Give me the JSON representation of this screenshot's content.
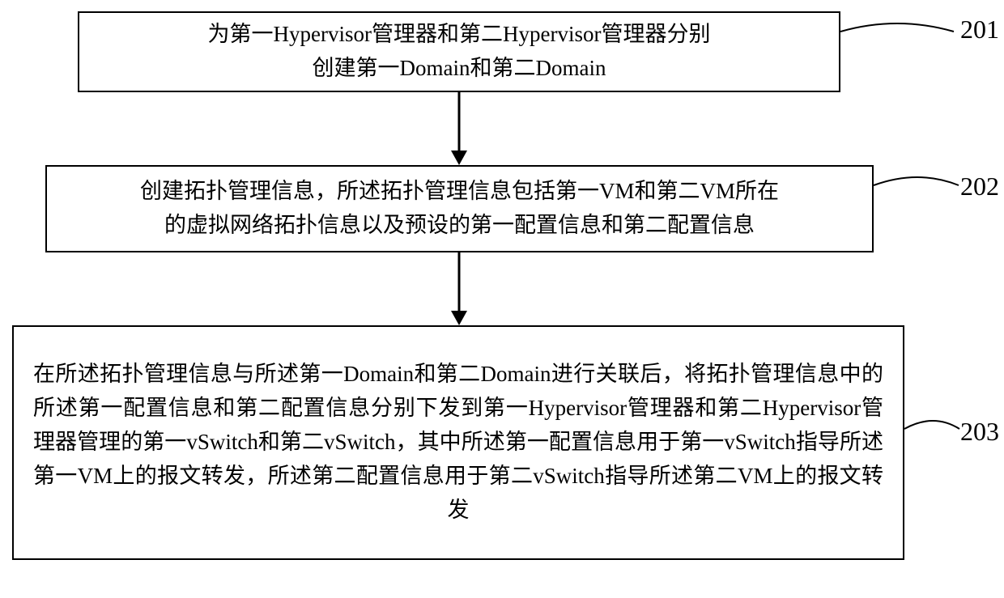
{
  "chart_data": {
    "type": "flowchart",
    "direction": "top-to-bottom",
    "nodes": [
      {
        "id": "201",
        "label_ref": "201",
        "text": "为第一Hypervisor管理器和第二Hypervisor管理器分别创建第一Domain和第二Domain"
      },
      {
        "id": "202",
        "label_ref": "202",
        "text": "创建拓扑管理信息，所述拓扑管理信息包括第一VM和第二VM所在的虚拟网络拓扑信息以及预设的第一配置信息和第二配置信息"
      },
      {
        "id": "203",
        "label_ref": "203",
        "text": "在所述拓扑管理信息与所述第一Domain和第二Domain进行关联后，将拓扑管理信息中的所述第一配置信息和第二配置信息分别下发到第一Hypervisor管理器和第二Hypervisor管理器管理的第一vSwitch和第二vSwitch，其中所述第一配置信息用于第一vSwitch指导所述第一VM上的报文转发，所述第二配置信息用于第二vSwitch指导所述第二VM上的报文转发"
      }
    ],
    "edges": [
      {
        "from": "201",
        "to": "202"
      },
      {
        "from": "202",
        "to": "203"
      }
    ]
  },
  "boxes": {
    "b1": "为第一Hypervisor管理器和第二Hypervisor管理器分别\n创建第一Domain和第二Domain",
    "b2": "创建拓扑管理信息，所述拓扑管理信息包括第一VM和第二VM所在\n的虚拟网络拓扑信息以及预设的第一配置信息和第二配置信息",
    "b3": "在所述拓扑管理信息与所述第一Domain和第二Domain进行关联后，将拓扑管理信息中的所述第一配置信息和第二配置信息分别下发到第一Hypervisor管理器和第二Hypervisor管理器管理的第一vSwitch和第二vSwitch，其中所述第一配置信息用于第一vSwitch指导所述第一VM上的报文转发，所述第二配置信息用于第二vSwitch指导所述第二VM上的报文转发"
  },
  "labels": {
    "l1": "201",
    "l2": "202",
    "l3": "203"
  }
}
